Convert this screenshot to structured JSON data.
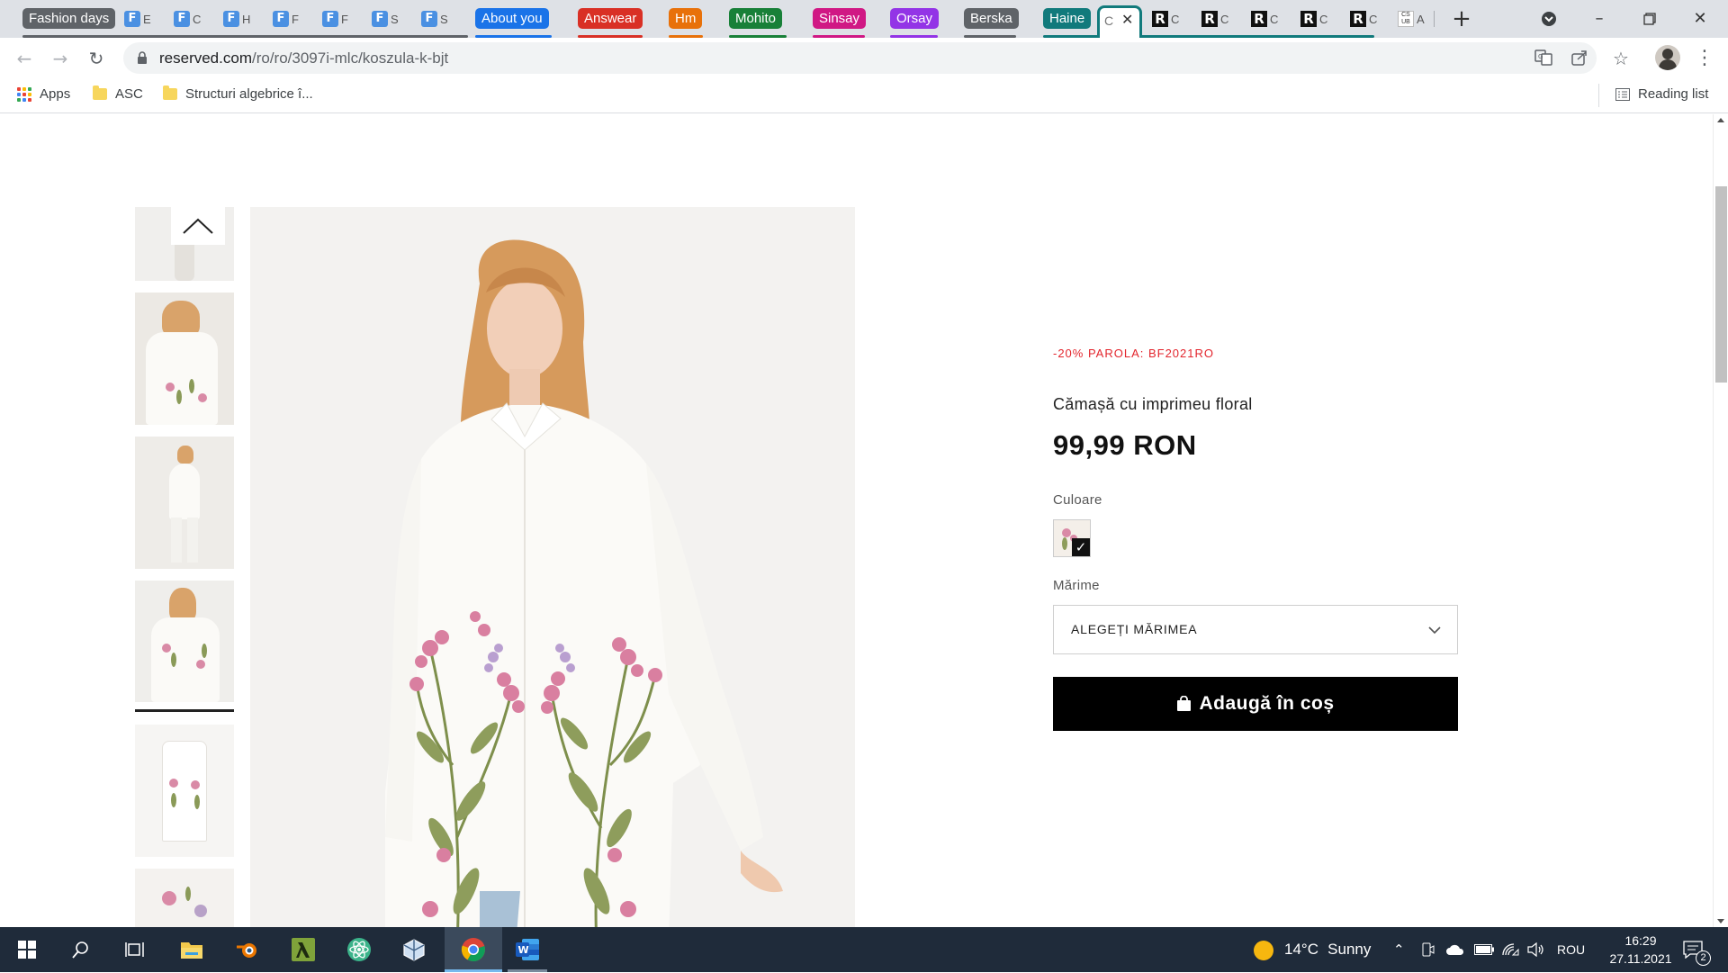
{
  "browser": {
    "tab_groups": [
      {
        "label": "Fashion days",
        "color": "#5f6368"
      },
      {
        "label": "About you",
        "color": "#1a73e8"
      },
      {
        "label": "Answear",
        "color": "#d93025"
      },
      {
        "label": "Hm",
        "color": "#e8710a"
      },
      {
        "label": "Mohito",
        "color": "#188038"
      },
      {
        "label": "Sinsay",
        "color": "#d01884"
      },
      {
        "label": "Orsay",
        "color": "#9334e6"
      },
      {
        "label": "Berska",
        "color": "#5f6368"
      },
      {
        "label": "Haine",
        "color": "#117a7c"
      }
    ],
    "tabs_fd": [
      {
        "title": "E"
      },
      {
        "title": "C"
      },
      {
        "title": "H"
      },
      {
        "title": "F"
      },
      {
        "title": "F"
      },
      {
        "title": "S"
      },
      {
        "title": "S"
      }
    ],
    "tabs_haine": [
      {
        "title": "C"
      },
      {
        "title": "C"
      },
      {
        "title": "C"
      },
      {
        "title": "C"
      },
      {
        "title": "C"
      }
    ],
    "csub_tab": {
      "icon_text": "CS UB",
      "title": "A"
    },
    "active_tab": {
      "title": "C"
    },
    "url_host": "reserved.com",
    "url_path": "/ro/ro/3097i-mlc/koszula-k-bjt",
    "bookmarks": [
      {
        "label": "Apps",
        "icon": "apps-grid-icon"
      },
      {
        "label": "ASC",
        "icon": "folder-icon"
      },
      {
        "label": "Structuri algebrice î...",
        "icon": "folder-icon"
      }
    ],
    "reading_list": "Reading list"
  },
  "product": {
    "promo": "-20% PAROLA: BF2021RO",
    "name": "Cămașă cu imprimeu floral",
    "price": "99,99 RON",
    "color_label": "Culoare",
    "size_label": "Mărime",
    "size_placeholder": "ALEGEȚI MĂRIMEA",
    "add_to_cart": "Adaugă în coș",
    "colors": {
      "promo": "#e3252d",
      "button": "#000000"
    }
  },
  "taskbar": {
    "weather_temp": "14°C",
    "weather_desc": "Sunny",
    "language": "ROU",
    "time": "16:29",
    "date": "27.11.2021",
    "notifications": "2"
  }
}
